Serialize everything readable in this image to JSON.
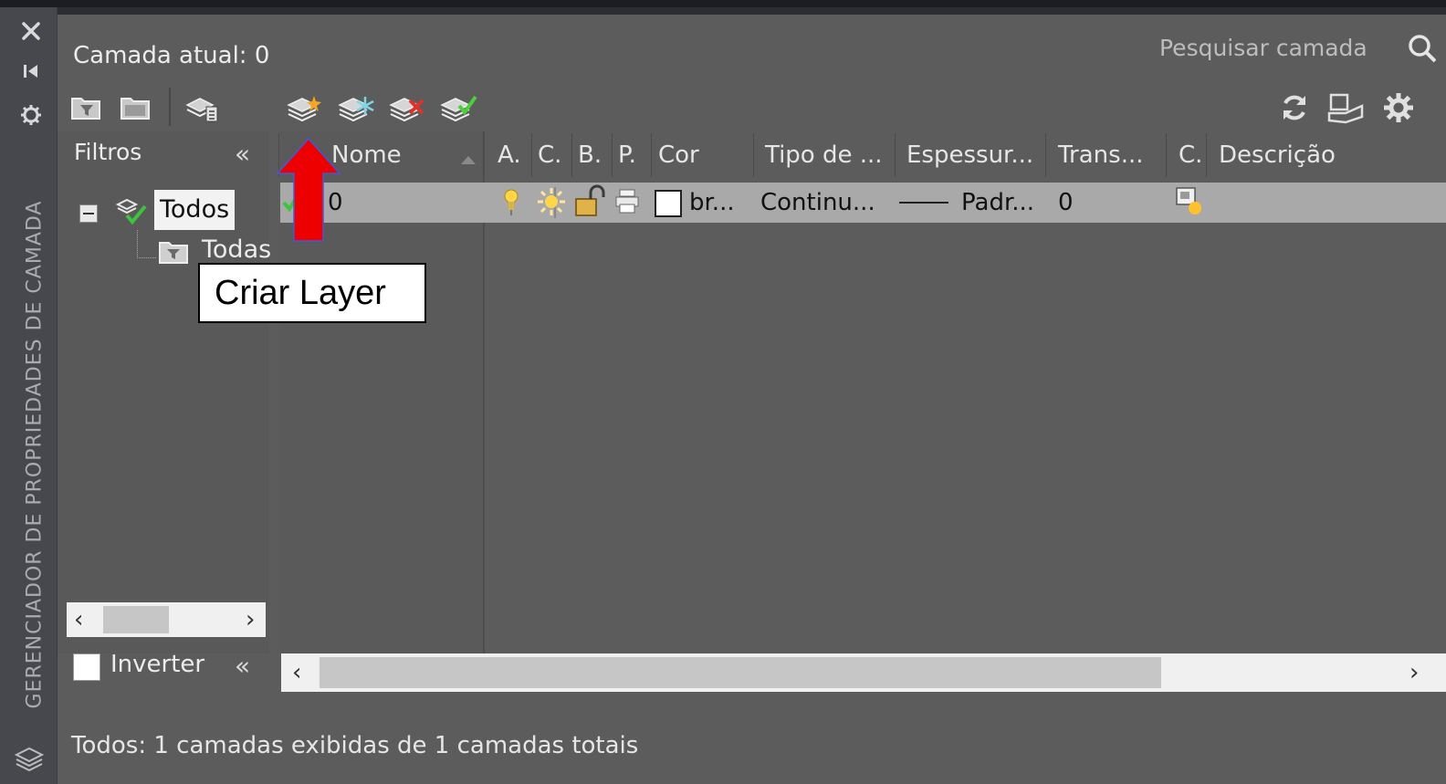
{
  "palette": {
    "side_title": "GERENCIADOR DE PROPRIEDADES DE CAMADA",
    "current_layer": "Camada atual: 0",
    "search_placeholder": "Pesquisar camada"
  },
  "filters": {
    "header": "Filtros",
    "tree": {
      "root": "Todos",
      "child": "Todas"
    },
    "invert_label": "Inverter"
  },
  "table": {
    "columns": [
      "A.",
      "C.",
      "B.",
      "P.",
      "Cor",
      "Tipo de ...",
      "Espessur...",
      "Trans...",
      "C.",
      "Descrição"
    ],
    "name_header": "Nome",
    "rows": [
      {
        "name": "0",
        "color": "br...",
        "linetype": "Continu...",
        "lineweight": "Padr...",
        "transparency": "0"
      }
    ]
  },
  "status": "Todos: 1 camadas exibidas de 1 camadas totais",
  "annotation": {
    "text": "Criar Layer",
    "color": "#ee0000"
  }
}
